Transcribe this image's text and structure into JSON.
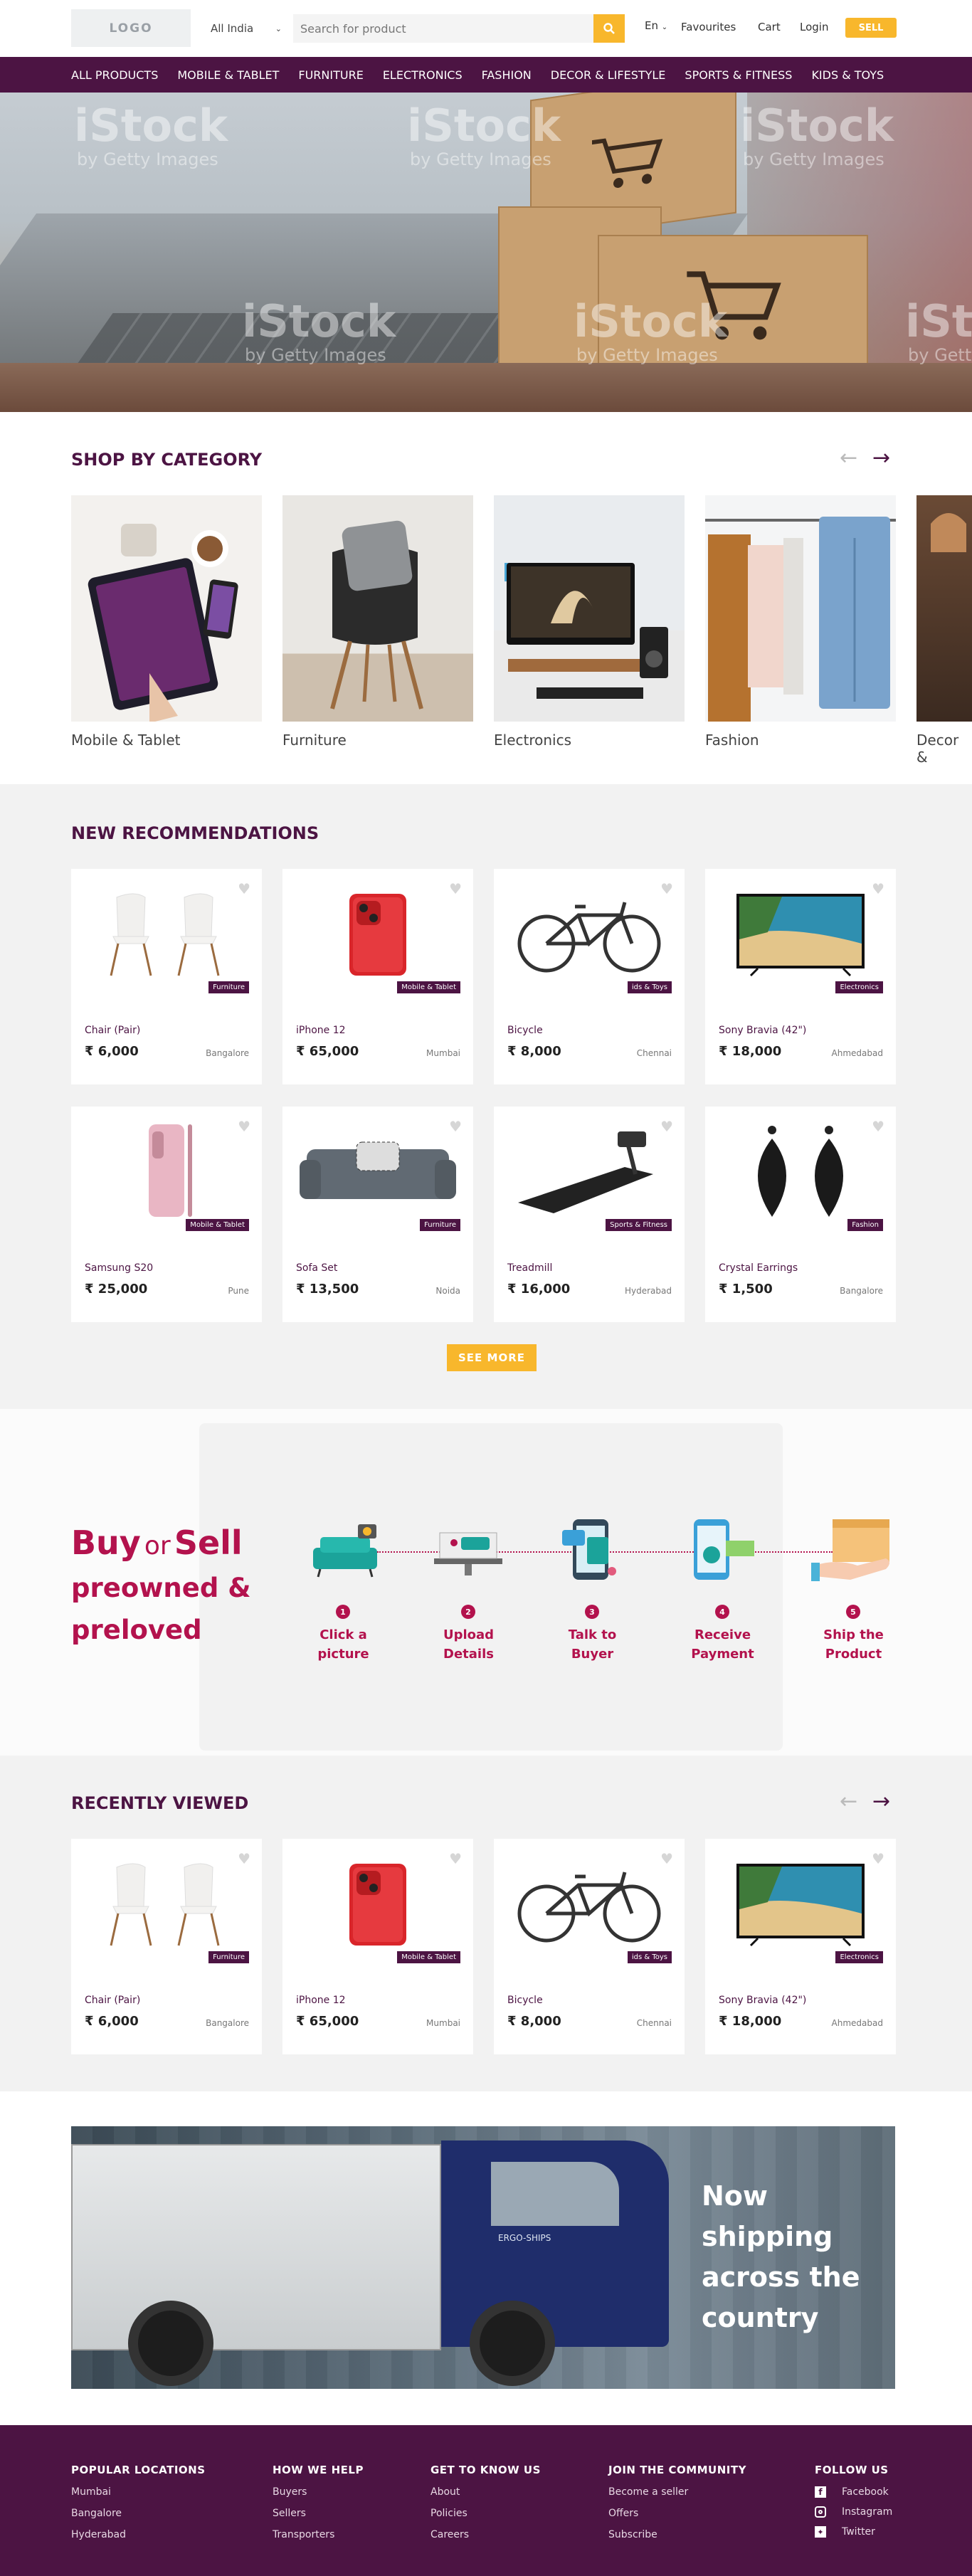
{
  "header": {
    "logo": "LOGO",
    "location": "All India",
    "search_placeholder": "Search for product",
    "language": "En",
    "links": [
      "Favourites",
      "Cart",
      "Login"
    ],
    "sell": "SELL"
  },
  "nav": [
    "ALL PRODUCTS",
    "MOBILE & TABLET",
    "FURNITURE",
    "ELECTRONICS",
    "FASHION",
    "DECOR & LIFESTYLE",
    "SPORTS & FITNESS",
    "KIDS & TOYS"
  ],
  "hero": {
    "watermark": "iStock",
    "watermark_sub": "by Getty Images"
  },
  "shop_by_category": {
    "title": "SHOP BY CATEGORY",
    "categories": [
      "Mobile & Tablet",
      "Furniture",
      "Electronics",
      "Fashion",
      "Decor &"
    ]
  },
  "recommendations": {
    "title": "NEW RECOMMENDATIONS",
    "items": [
      {
        "name": "Chair (Pair)",
        "price": "₹ 6,000",
        "city": "Bangalore",
        "badge": "Furniture"
      },
      {
        "name": "iPhone 12",
        "price": "₹ 65,000",
        "city": "Mumbai",
        "badge": "Mobile & Tablet"
      },
      {
        "name": "Bicycle",
        "price": "₹ 8,000",
        "city": "Chennai",
        "badge": "ids & Toys"
      },
      {
        "name": "Sony Bravia (42\")",
        "price": "₹ 18,000",
        "city": "Ahmedabad",
        "badge": "Electronics"
      },
      {
        "name": "Samsung S20",
        "price": "₹ 25,000",
        "city": "Pune",
        "badge": "Mobile & Tablet"
      },
      {
        "name": "Sofa Set",
        "price": "₹ 13,500",
        "city": "Noida",
        "badge": "Furniture"
      },
      {
        "name": "Treadmill",
        "price": "₹ 16,000",
        "city": "Hyderabad",
        "badge": "Sports & Fitness"
      },
      {
        "name": "Crystal Earrings",
        "price": "₹ 1,500",
        "city": "Bangalore",
        "badge": "Fashion"
      }
    ],
    "see_more": "SEE MORE"
  },
  "buy_sell": {
    "buy": "Buy",
    "or": "or",
    "sell": "Sell",
    "line2": "preowned &",
    "line3": "preloved",
    "steps": [
      {
        "num": "1",
        "l1": "Click a",
        "l2": "picture"
      },
      {
        "num": "2",
        "l1": "Upload",
        "l2": "Details"
      },
      {
        "num": "3",
        "l1": "Talk to",
        "l2": "Buyer"
      },
      {
        "num": "4",
        "l1": "Receive",
        "l2": "Payment"
      },
      {
        "num": "5",
        "l1": "Ship the",
        "l2": "Product"
      }
    ]
  },
  "recently_viewed": {
    "title": "RECENTLY VIEWED",
    "items": [
      {
        "name": "Chair (Pair)",
        "price": "₹ 6,000",
        "city": "Bangalore",
        "badge": "Furniture"
      },
      {
        "name": "iPhone 12",
        "price": "₹ 65,000",
        "city": "Mumbai",
        "badge": "Mobile & Tablet"
      },
      {
        "name": "Bicycle",
        "price": "₹ 8,000",
        "city": "Chennai",
        "badge": "ids & Toys"
      },
      {
        "name": "Sony Bravia (42\")",
        "price": "₹ 18,000",
        "city": "Ahmedabad",
        "badge": "Electronics"
      }
    ]
  },
  "shipping": {
    "l1": "Now",
    "l2": "shipping",
    "l3": "across the",
    "l4": "country",
    "truck_text": "ERGO-SHIPS"
  },
  "footer": {
    "cols": [
      {
        "title": "POPULAR LOCATIONS",
        "links": [
          "Mumbai",
          "Bangalore",
          "Hyderabad"
        ]
      },
      {
        "title": "HOW WE HELP",
        "links": [
          "Buyers",
          "Sellers",
          "Transporters"
        ]
      },
      {
        "title": "GET TO KNOW US",
        "links": [
          "About",
          "Policies",
          "Careers"
        ]
      },
      {
        "title": "JOIN THE COMMUNITY",
        "links": [
          "Become a seller",
          "Offers",
          "Subscribe"
        ]
      },
      {
        "title": "FOLLOW US",
        "links": [
          "Facebook",
          "Instagram",
          "Twitter"
        ]
      }
    ]
  },
  "colors": {
    "brand": "#4c1443",
    "accent": "#f8b72c",
    "magenta": "#b3124d"
  }
}
